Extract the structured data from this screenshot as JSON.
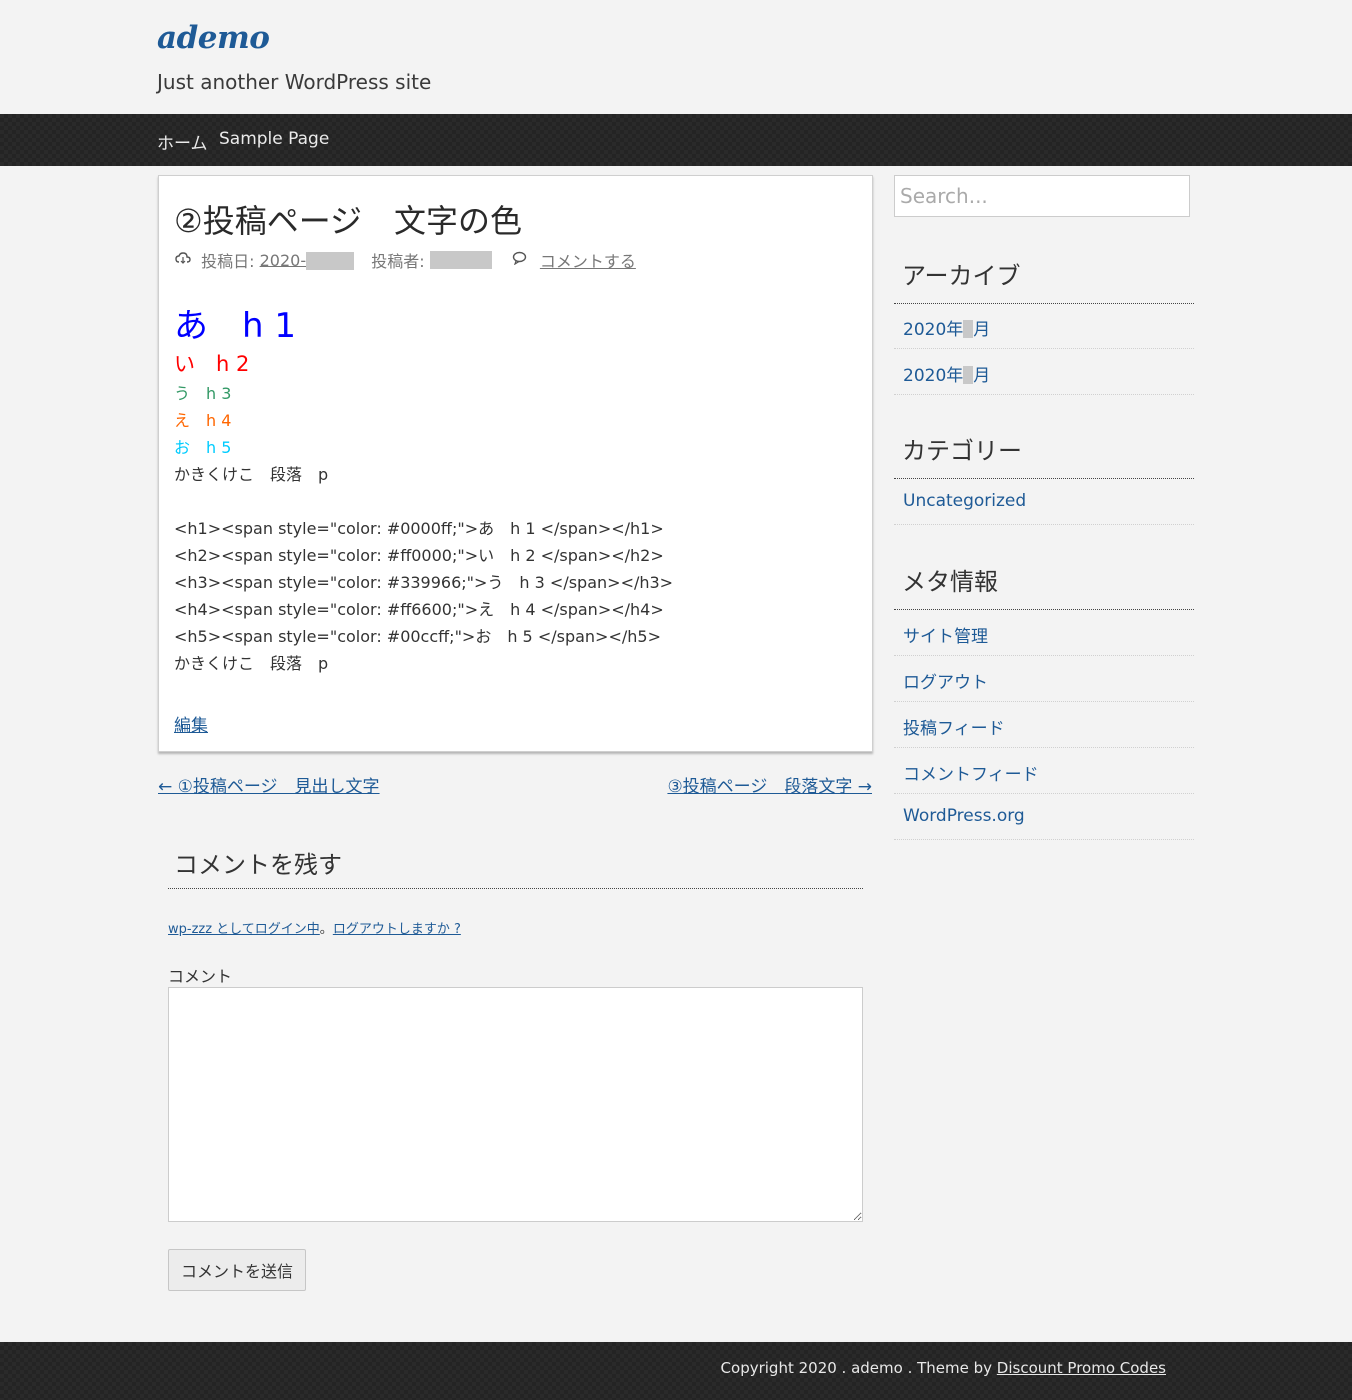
{
  "site": {
    "title": "ademo",
    "description": "Just another WordPress site"
  },
  "nav": {
    "items": [
      {
        "label": "ホーム"
      },
      {
        "label": "Sample Page"
      }
    ]
  },
  "post": {
    "title": "②投稿ページ　文字の色",
    "meta": {
      "date_label": "投稿日:",
      "date_value": "2020-",
      "author_label": "投稿者:",
      "comment_link": "コメントする"
    },
    "headings": {
      "h1": "あ　h 1",
      "h2": "い　h 2",
      "h3": "う　h 3",
      "h4": "え　h 4",
      "h5": "お　h 5",
      "p": "かきくけこ　段落　p"
    },
    "code_lines": [
      "<h1><span style=\"color: #0000ff;\">あ　h 1 </span></h1>",
      "<h2><span style=\"color: #ff0000;\">い　h 2 </span></h2>",
      "<h3><span style=\"color: #339966;\">う　h 3 </span></h3>",
      "<h4><span style=\"color: #ff6600;\">え　h 4 </span></h4>",
      "<h5><span style=\"color: #00ccff;\">お　h 5 </span></h5>",
      "かきくけこ　段落　p"
    ],
    "edit_link": "編集"
  },
  "post_nav": {
    "prev": "← ①投稿ページ　見出し文字",
    "next": "③投稿ページ　段落文字 →"
  },
  "comments": {
    "heading": "コメントを残す",
    "logged_in_as": "wp-zzz としてログイン中",
    "separator": "。",
    "logout": "ログアウトしますか ?",
    "label": "コメント",
    "submit": "コメントを送信"
  },
  "sidebar": {
    "search_placeholder": "Search...",
    "archives": {
      "title": "アーカイブ",
      "items": [
        {
          "prefix": "2020年",
          "suffix": "月"
        },
        {
          "prefix": "2020年",
          "suffix": "月"
        }
      ]
    },
    "categories": {
      "title": "カテゴリー",
      "items": [
        {
          "label": "Uncategorized"
        }
      ]
    },
    "meta": {
      "title": "メタ情報",
      "items": [
        {
          "label": "サイト管理"
        },
        {
          "label": "ログアウト"
        },
        {
          "label": "投稿フィード"
        },
        {
          "label": "コメントフィード"
        },
        {
          "label": "WordPress.org"
        }
      ]
    }
  },
  "footer": {
    "copyright": "Copyright 2020 . ademo . Theme by ",
    "theme_link": "Discount Promo Codes"
  },
  "colors": {
    "link": "#1e5a96",
    "h1": "#0000ff",
    "h2": "#ff0000",
    "h3": "#339966",
    "h4": "#ff6600",
    "h5": "#00ccff"
  }
}
